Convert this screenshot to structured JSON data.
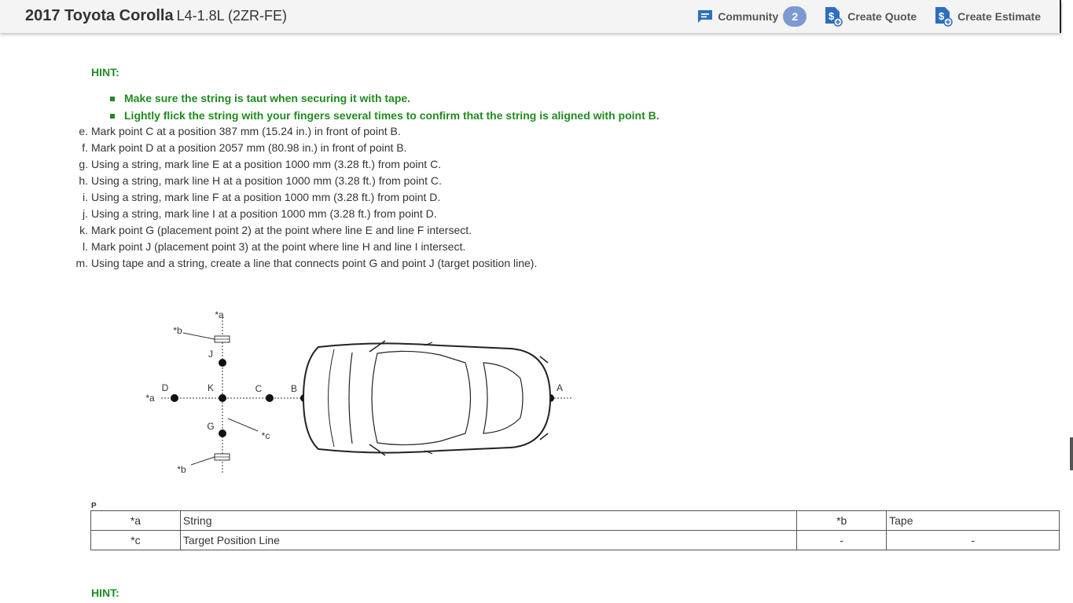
{
  "header": {
    "vehicle_model": "2017 Toyota Corolla",
    "vehicle_engine": "L4-1.8L (2ZR-FE)",
    "community_label": "Community",
    "community_count": "2",
    "create_quote_label": "Create Quote",
    "create_estimate_label": "Create Estimate",
    "icons": [
      "chat-icon",
      "quote-icon",
      "estimate-icon"
    ],
    "accent_color": "#2d6fbf",
    "badge_color": "#7b9ad1"
  },
  "hint1": {
    "title": "HINT:",
    "bullets": [
      "Make sure the string is taut when securing it with tape.",
      "Lightly flick the string with your fingers several times to confirm that the string is aligned with point B."
    ],
    "color": "#1f8c1f"
  },
  "steps": [
    {
      "letter": "e.",
      "text": "Mark point C at a position 387 mm (15.24 in.) in front of point B."
    },
    {
      "letter": "f.",
      "text": "Mark point D at a position 2057 mm (80.98 in.) in front of point B."
    },
    {
      "letter": "g.",
      "text": "Using a string, mark line E at a position 1000 mm (3.28 ft.) from point C."
    },
    {
      "letter": "h.",
      "text": "Using a string, mark line H at a position 1000 mm (3.28 ft.) from point C."
    },
    {
      "letter": "i.",
      "text": "Using a string, mark line F at a position 1000 mm (3.28 ft.) from point D."
    },
    {
      "letter": "j.",
      "text": "Using a string, mark line I at a position 1000 mm (3.28 ft.) from point D."
    },
    {
      "letter": "k.",
      "text": "Mark point G (placement point 2) at the point where line E and line F intersect."
    },
    {
      "letter": "l.",
      "text": "Mark point J (placement point 3) at the point where line H and line I intersect."
    },
    {
      "letter": "m.",
      "text": "Using tape and a string, create a line that connects point G and point J (target position line)."
    }
  ],
  "diagram": {
    "labels": {
      "a_top": "*a",
      "b_top": "*b",
      "J": "J",
      "D": "D",
      "K": "K",
      "C": "C",
      "B": "B",
      "A": "A",
      "a_left": "*a",
      "G": "G",
      "c": "*c",
      "b_bottom": "*b"
    }
  },
  "figure_code": "P",
  "legend": {
    "rows": [
      [
        "*a",
        "String",
        "*b",
        "Tape"
      ],
      [
        "*c",
        "Target Position Line",
        "-",
        "-"
      ]
    ]
  },
  "hint2": {
    "title": "HINT:"
  }
}
